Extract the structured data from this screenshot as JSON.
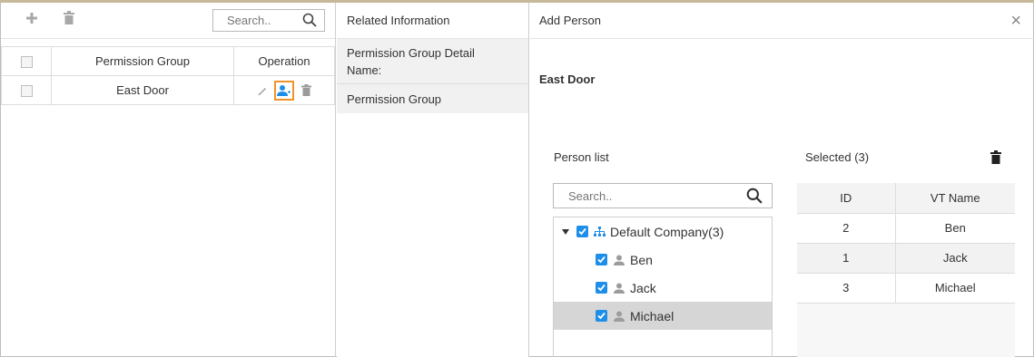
{
  "left_panel": {
    "search_placeholder": "Search..",
    "columns": {
      "group": "Permission Group",
      "operation": "Operation"
    },
    "rows": [
      {
        "name": "East Door"
      }
    ]
  },
  "middle_panel": {
    "title": "Related Information",
    "detail_label": "Permission Group Detail",
    "name_label": "Name:",
    "group_item": "Permission Group"
  },
  "right_panel": {
    "title": "Add Person",
    "group_name": "East Door",
    "person_list_label": "Person list",
    "search_placeholder": "Search..",
    "tree": {
      "company": "Default Company(3)",
      "persons": [
        "Ben",
        "Jack",
        "Michael"
      ],
      "selected_person": "Michael"
    },
    "selected_label": "Selected (3)",
    "selected_columns": {
      "id": "ID",
      "name": "VT Name"
    },
    "selected_rows": [
      {
        "id": "2",
        "name": "Ben"
      },
      {
        "id": "1",
        "name": "Jack"
      },
      {
        "id": "3",
        "name": "Michael"
      }
    ]
  },
  "colors": {
    "accent_blue": "#1e8ee9",
    "highlight_orange": "#f0932b"
  }
}
